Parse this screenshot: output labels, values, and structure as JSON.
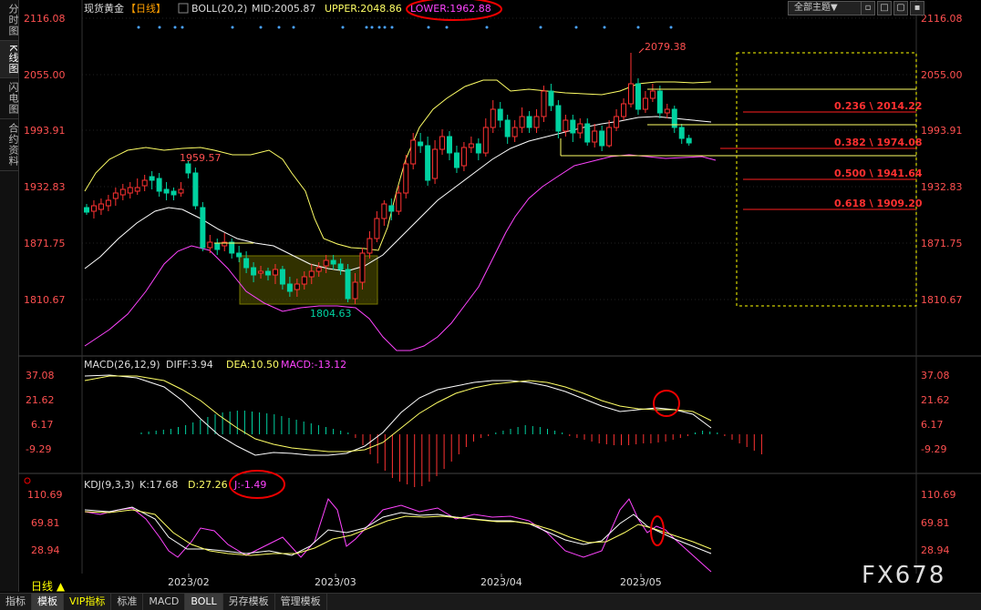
{
  "left_tabs": [
    "分时图",
    "K线图",
    "闪电图",
    "合约资料"
  ],
  "header": {
    "instrument": "现货黄金",
    "period_tag": "【日线】",
    "boll_name": "BOLL(20,2)",
    "mid": "MID:2005.87",
    "upper": "UPPER:2048.86",
    "lower": "LOWER:1962.88",
    "theme": "全部主题▼"
  },
  "price_axis": [
    "2116.08",
    "2055.00",
    "1993.91",
    "1932.83",
    "1871.75",
    "1810.67"
  ],
  "annotations": {
    "high": "2079.38",
    "prev_high": "1959.57",
    "low": "1804.63"
  },
  "fib_levels": [
    {
      "label": "0.236 \\ 2014.22"
    },
    {
      "label": "0.382 \\ 1974.08"
    },
    {
      "label": "0.500 \\ 1941.64"
    },
    {
      "label": "0.618 \\ 1909.20"
    }
  ],
  "macd": {
    "title": "MACD(26,12,9)",
    "diff": "DIFF:3.94",
    "dea": "DEA:10.50",
    "macd": "MACD:-13.12",
    "axis": [
      "37.08",
      "21.62",
      "6.17",
      "-9.29"
    ]
  },
  "kdj": {
    "title": "KDJ(9,3,3)",
    "k": "K:17.68",
    "d": "D:27.26",
    "j": "J:-1.49",
    "axis": [
      "110.69",
      "69.81",
      "28.94"
    ]
  },
  "time_axis": [
    "2023/02",
    "2023/03",
    "2023/04",
    "2023/05"
  ],
  "period_label": "日线 ▲",
  "bottom_tabs": [
    "指标",
    "模板",
    "VIP指标",
    "标准",
    "MACD",
    "BOLL",
    "另存模板",
    "管理模板"
  ],
  "watermark": "FX678",
  "colors": {
    "up": "#ff3232",
    "down": "#00d2a0",
    "boll_mid": "#ffffff",
    "boll_upper": "#ffff66",
    "boll_lower": "#ff44ff",
    "axis_red": "#ff5050"
  }
}
